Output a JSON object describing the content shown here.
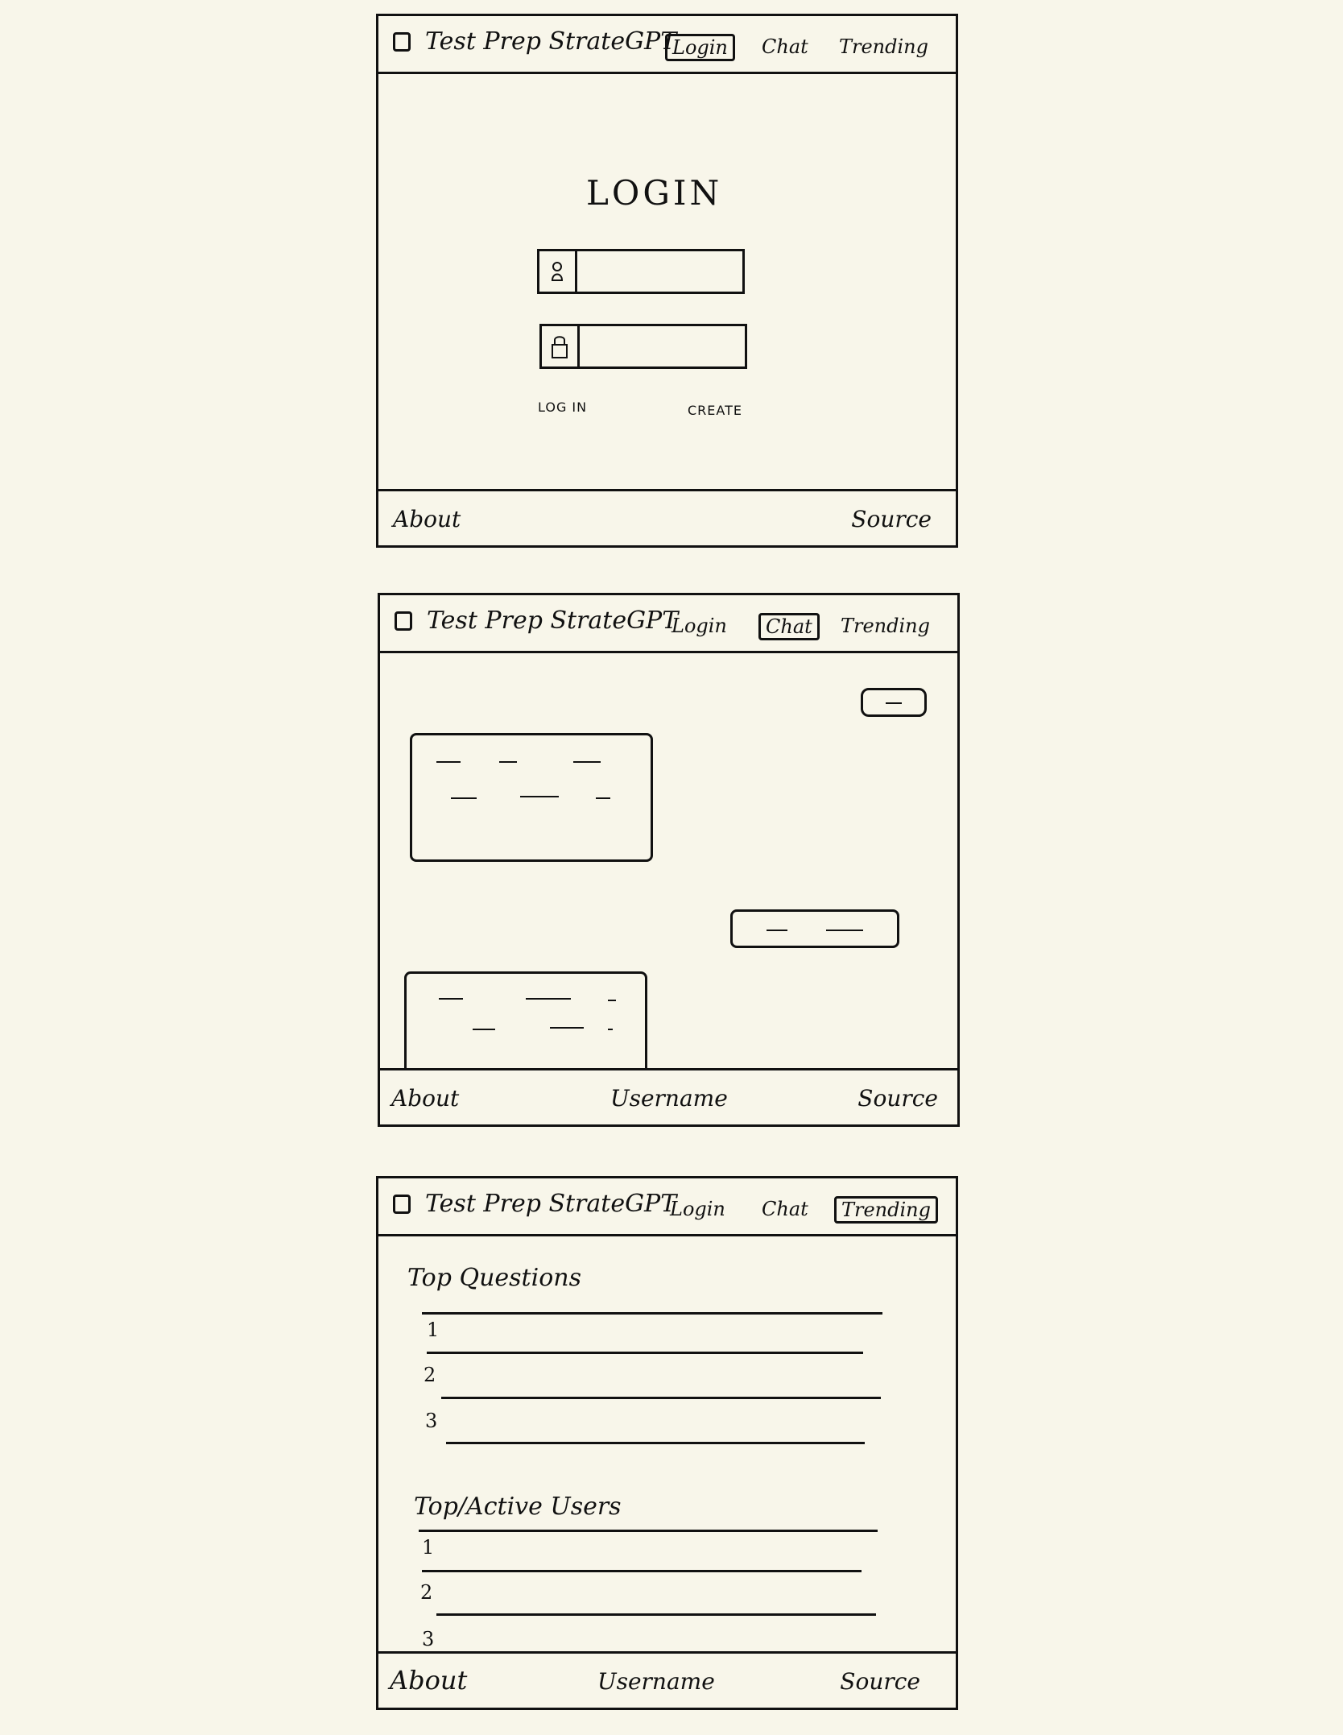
{
  "brand": "Test Prep StrateGPT",
  "nav": {
    "login": "Login",
    "chat": "Chat",
    "trending": "Trending"
  },
  "footer": {
    "about": "About",
    "username": "Username",
    "source": "Source"
  },
  "login_page": {
    "title": "LOGIN",
    "username_icon": "user-icon",
    "password_icon": "lock-icon",
    "login_link": "LOG IN",
    "create_link": "CREATE"
  },
  "trending_page": {
    "top_questions_title": "Top Questions",
    "top_users_title": "Top/Active Users",
    "ranks": [
      "1",
      "2",
      "3"
    ]
  }
}
